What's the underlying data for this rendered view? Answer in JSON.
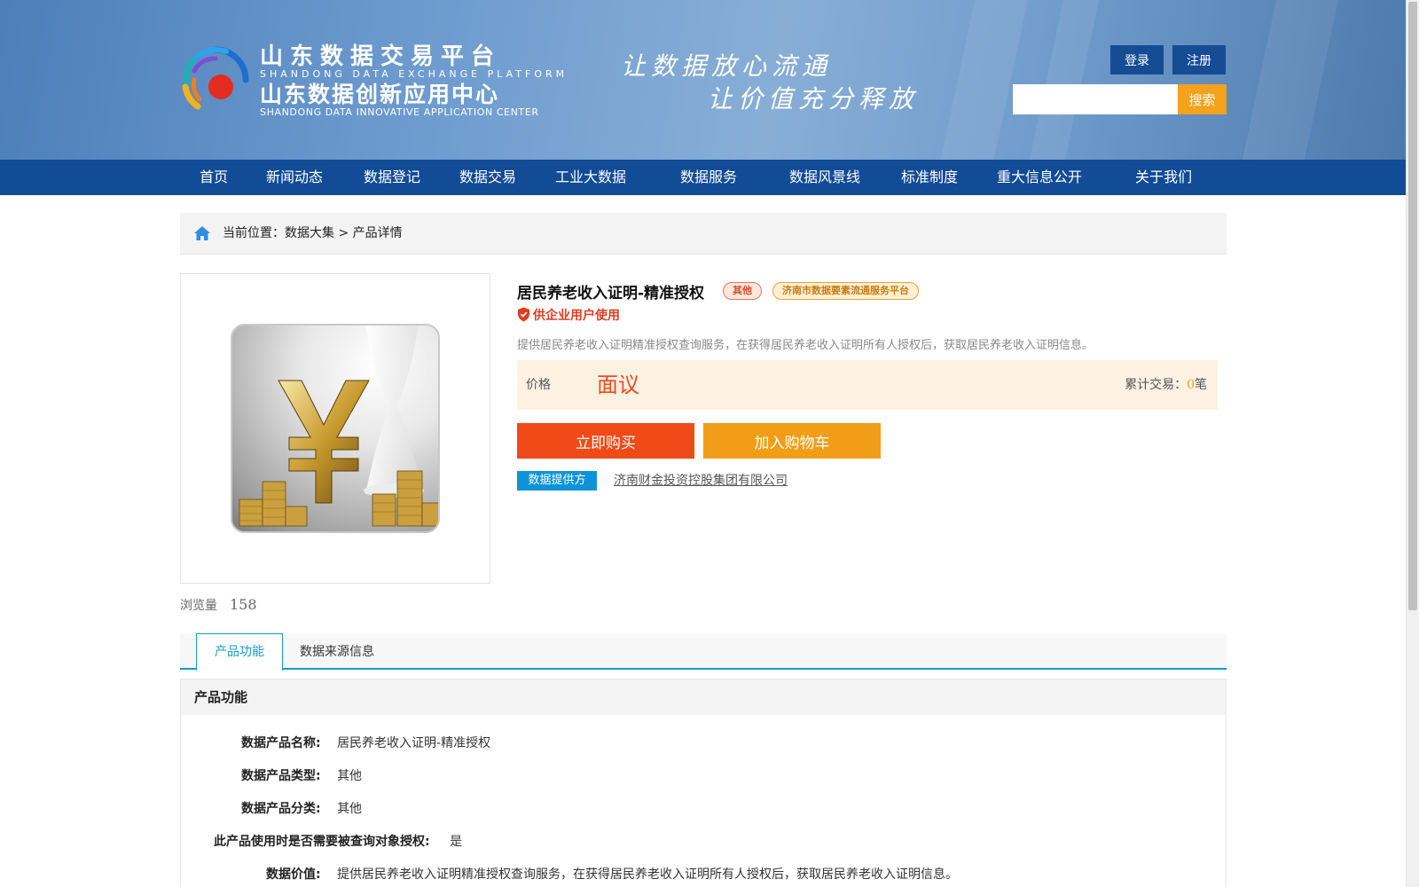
{
  "header": {
    "logo_cn1": "山东数据交易平台",
    "logo_en1": "SHANDONG DATA EXCHANGE PLATFORM",
    "logo_cn2": "山东数据创新应用中心",
    "logo_en2": "SHANDONG DATA INNOVATIVE APPLICATION CENTER",
    "slogan1": "让数据放心流通",
    "slogan2": "让价值充分释放",
    "login_label": "登录",
    "register_label": "注册",
    "search_value": "",
    "search_label": "搜索"
  },
  "nav": {
    "items": [
      "首页",
      "新闻动态",
      "数据登记",
      "数据交易",
      "工业大数据",
      "数据服务",
      "数据风景线",
      "标准制度",
      "重大信息公开",
      "关于我们"
    ]
  },
  "breadcrumb": {
    "prefix": "当前位置：",
    "level1": "数据大集",
    "sep": " > ",
    "level2": "产品详情"
  },
  "product": {
    "title": "居民养老收入证明-精准授权",
    "category_tag": "其他",
    "platform_tag": "济南市数据要素流通服务平台",
    "enterprise_note": "供企业用户使用",
    "description": "提供居民养老收入证明精准授权查询服务，在获得居民养老收入证明所有人授权后，获取居民养老收入证明信息。",
    "price_label": "价格",
    "price_value": "面议",
    "trade_label": "累计交易：",
    "trade_count": "0",
    "trade_unit": "笔",
    "buy_label": "立即购买",
    "cart_label": "加入购物车",
    "provider_label": "数据提供方",
    "provider_name": "济南财金投资控股集团有限公司",
    "views_label": "浏览量",
    "views_count": "158"
  },
  "tabs": {
    "items": [
      "产品功能",
      "数据来源信息"
    ],
    "active": "产品功能"
  },
  "section": {
    "title": "产品功能",
    "fields": [
      {
        "key": "数据产品名称:",
        "value": "居民养老收入证明-精准授权"
      },
      {
        "key": "数据产品类型:",
        "value": "其他"
      },
      {
        "key": "数据产品分类:",
        "value": "其他"
      },
      {
        "key": "此产品使用时是否需要被查询对象授权:",
        "value": "是"
      },
      {
        "key": "数据价值:",
        "value": "提供居民养老收入证明精准授权查询服务，在获得居民养老收入证明所有人授权后，获取居民养老收入证明信息。"
      }
    ]
  },
  "colors": {
    "nav_bg": "#124b96",
    "accent_orange": "#ef4a18",
    "accent_yellow": "#f29d18",
    "tab_blue": "#1898c7",
    "provider_blue": "#0e93d8"
  }
}
